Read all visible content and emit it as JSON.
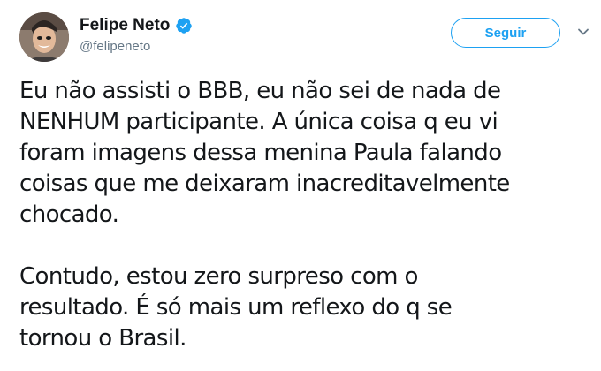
{
  "tweet": {
    "author": {
      "display_name": "Felipe Neto",
      "handle": "@felipeneto",
      "verified": true,
      "avatar_icon": "avatar-photo"
    },
    "follow_label": "Seguir",
    "menu_icon": "chevron-down-icon",
    "paragraphs": [
      {
        "lines": [
          "Eu não assisti o BBB, eu não sei de nada de",
          "NENHUM participante. A única coisa q eu vi",
          "foram imagens dessa menina Paula falando",
          "coisas que me deixaram inacreditavelmente",
          "chocado."
        ]
      },
      {
        "lines": [
          "Contudo, estou zero surpreso com o",
          "resultado. É só mais um reflexo do q se",
          "tornou o Brasil."
        ]
      }
    ]
  },
  "colors": {
    "accent": "#1da1f2",
    "text": "#14171a",
    "muted": "#657786"
  }
}
